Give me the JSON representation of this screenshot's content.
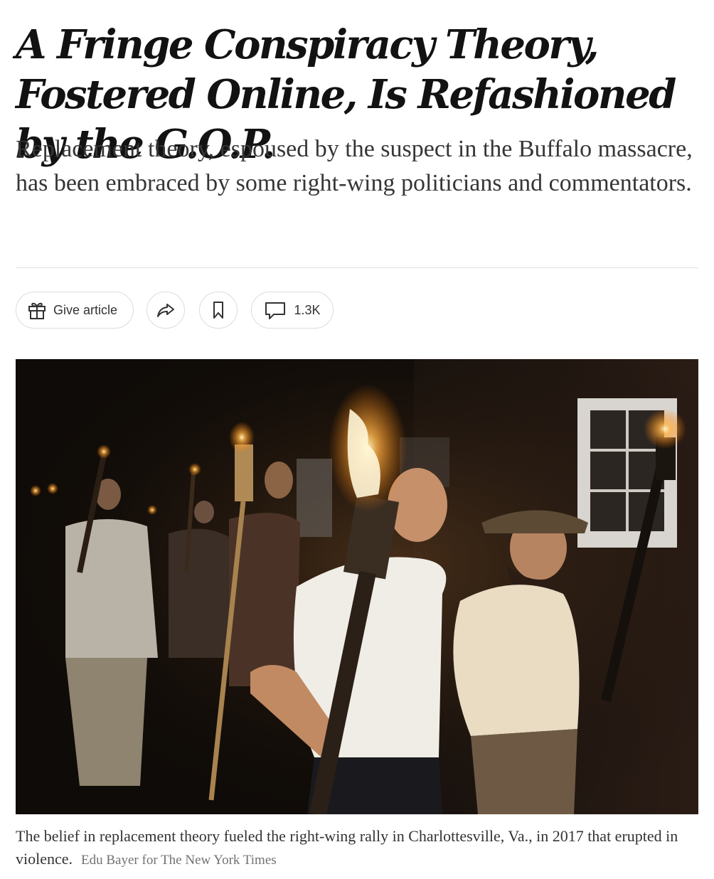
{
  "article": {
    "headline": "A Fringe Conspiracy Theory, Fostered Online, Is Refashioned by the G.O.P.",
    "summary": "Replacement theory, espoused by the suspect in the Buffalo massacre, has been embraced by some right-wing politicians and commentators."
  },
  "toolbar": {
    "gift_label": "Give article",
    "comment_count": "1.3K",
    "icons": [
      "gift-icon",
      "share-icon",
      "bookmark-icon",
      "comment-icon"
    ]
  },
  "media": {
    "caption": "The belief in replacement theory fueled the right-wing rally in Charlottesville, Va., in 2017 that erupted in violence.",
    "credit": "Edu Bayer for The New York Times"
  },
  "colors": {
    "text": "#121212",
    "summary": "#363636",
    "border": "#dcdcdc",
    "credit": "#727272"
  }
}
